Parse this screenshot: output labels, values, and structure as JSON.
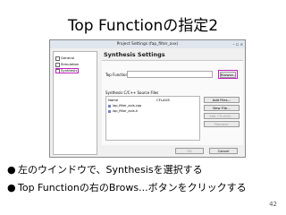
{
  "slide": {
    "title": "Top Functionの指定2",
    "bullets": [
      "左のウインドウで、Synthesisを選択する",
      "Top Functionの右のBrows...ボタンをクリックする"
    ],
    "page_number": "42"
  },
  "dialog": {
    "title": "Project Settings (fap_filter_avx)",
    "window_buttons": "– ☐ ✕",
    "tree_items": [
      "General",
      "Simulation",
      "Synthesis"
    ],
    "panel_title": "Synthesis Settings",
    "top_function_label": "Top Function:",
    "top_function_value": "",
    "browse_label": "Browse...",
    "source_files_label": "Synthesis C/C++ Source Files",
    "table_headers": [
      "Name",
      "CFLAGS"
    ],
    "files": [
      "lap_filter_axis.cpp",
      "lap_filter_axis.h"
    ],
    "side_buttons": [
      "Add Files...",
      "New File...",
      "Edit CFLAGS...",
      "Remove"
    ],
    "ok_label": "OK",
    "cancel_label": "Cancel"
  },
  "colors": {
    "highlight": "#c020c0"
  }
}
